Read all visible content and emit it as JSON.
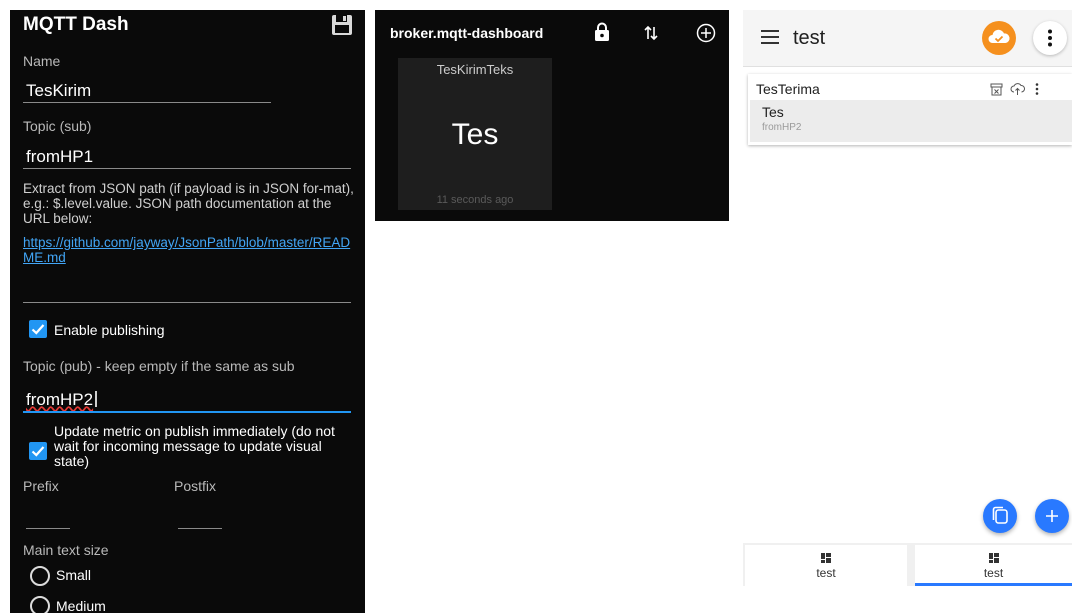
{
  "left": {
    "title": "MQTT Dash",
    "name_label": "Name",
    "name_value": "TesKirim",
    "topic_sub_label": "Topic (sub)",
    "topic_sub_value": "fromHP1",
    "json_help": "Extract from JSON path (if payload is in JSON for-mat), e.g.: $.level.value. JSON path documentation at the URL below:",
    "json_link": "https://github.com/jayway/JsonPath/blob/master/README.md",
    "enable_publishing": "Enable publishing",
    "topic_pub_label": "Topic (pub) - keep empty if the same as sub",
    "topic_pub_value": "fromHP2",
    "update_metric": "Update metric on publish immediately (do not wait for incoming message to update visual state)",
    "prefix_label": "Prefix",
    "postfix_label": "Postfix",
    "text_size_label": "Main text size",
    "size_small": "Small",
    "size_medium": "Medium"
  },
  "middle": {
    "broker": "broker.mqtt-dashboard",
    "tile_name": "TesKirimTeks",
    "tile_value": "Tes",
    "tile_time": "11 seconds ago"
  },
  "right": {
    "app_title": "test",
    "card_title": "TesTerima",
    "tile_value": "Tes",
    "tile_topic": "fromHP2",
    "tabs": [
      {
        "label": "test"
      },
      {
        "label": "test"
      }
    ],
    "colors": {
      "accent_orange": "#f5901e",
      "fab_blue": "#2979ff",
      "checkbox_blue": "#2196f3"
    }
  }
}
